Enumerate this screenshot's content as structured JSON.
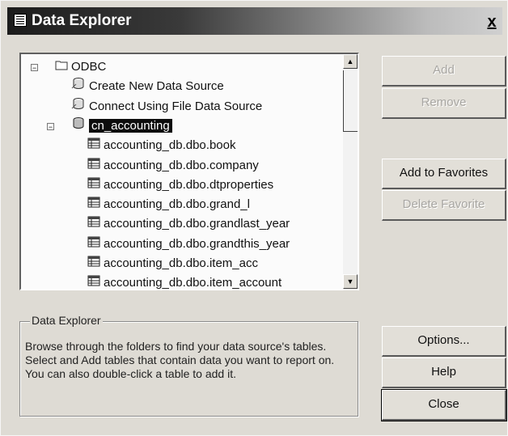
{
  "window": {
    "title": "Data Explorer",
    "close_label": "x"
  },
  "tree": {
    "items": [
      {
        "label": "ODBC",
        "icon": "folder-icon",
        "level": 0,
        "expander": "−"
      },
      {
        "label": "Create New Data Source",
        "icon": "datasource-icon",
        "level": 1
      },
      {
        "label": "Connect Using File Data Source",
        "icon": "datasource-icon",
        "level": 1
      },
      {
        "label": "cn_accounting",
        "icon": "database-icon",
        "level": 1,
        "expander": "−",
        "selected": true
      },
      {
        "label": "accounting_db.dbo.book",
        "icon": "table-icon",
        "level": 2
      },
      {
        "label": "accounting_db.dbo.company",
        "icon": "table-icon",
        "level": 2
      },
      {
        "label": "accounting_db.dbo.dtproperties",
        "icon": "table-icon",
        "level": 2
      },
      {
        "label": "accounting_db.dbo.grand_l",
        "icon": "table-icon",
        "level": 2
      },
      {
        "label": "accounting_db.dbo.grandlast_year",
        "icon": "table-icon",
        "level": 2
      },
      {
        "label": "accounting_db.dbo.grandthis_year",
        "icon": "table-icon",
        "level": 2
      },
      {
        "label": "accounting_db.dbo.item_acc",
        "icon": "table-icon",
        "level": 2
      },
      {
        "label": "accounting_db.dbo.item_account",
        "icon": "table-icon",
        "level": 2
      }
    ]
  },
  "buttons": {
    "add": "Add",
    "remove": "Remove",
    "add_to_favorites": "Add to Favorites",
    "delete_favorite": "Delete Favorite",
    "options": "Options...",
    "help": "Help",
    "close": "Close"
  },
  "info": {
    "legend": "Data Explorer",
    "text": "Browse through the folders to find your data source's tables.  Select and Add tables that contain data you want to report on.  You can also double-click a table to add it."
  }
}
